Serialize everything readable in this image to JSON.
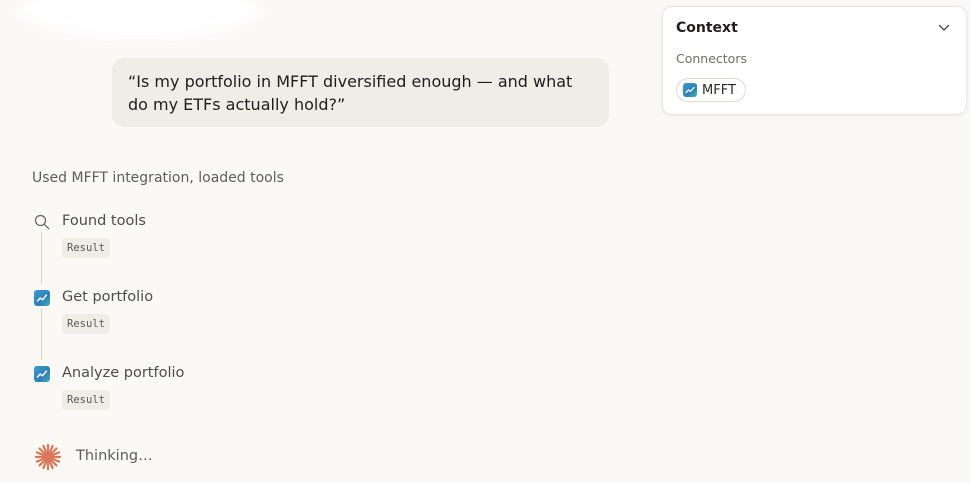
{
  "user_message": {
    "text": "“Is my portfolio in MFFT diversified enough — and what do my ETFs actually hold?”"
  },
  "context_panel": {
    "title": "Context",
    "connectors_label": "Connectors",
    "connectors": [
      {
        "name": "MFFT",
        "icon": "mfft-app-icon"
      }
    ]
  },
  "tool_activity": {
    "heading": "Used MFFT integration, loaded tools",
    "steps": [
      {
        "label": "Found tools",
        "icon": "search-icon",
        "result": "Result"
      },
      {
        "label": "Get portfolio",
        "icon": "mfft-app-icon",
        "result": "Result"
      },
      {
        "label": "Analyze portfolio",
        "icon": "mfft-app-icon",
        "result": "Result"
      }
    ]
  },
  "status": {
    "thinking_label": "Thinking…",
    "icon": "spark-icon",
    "accent_color": "#d97757"
  },
  "colors": {
    "background": "#faf9f6",
    "bubble": "#efede8",
    "mfft_icon": "#2f8fc4"
  }
}
